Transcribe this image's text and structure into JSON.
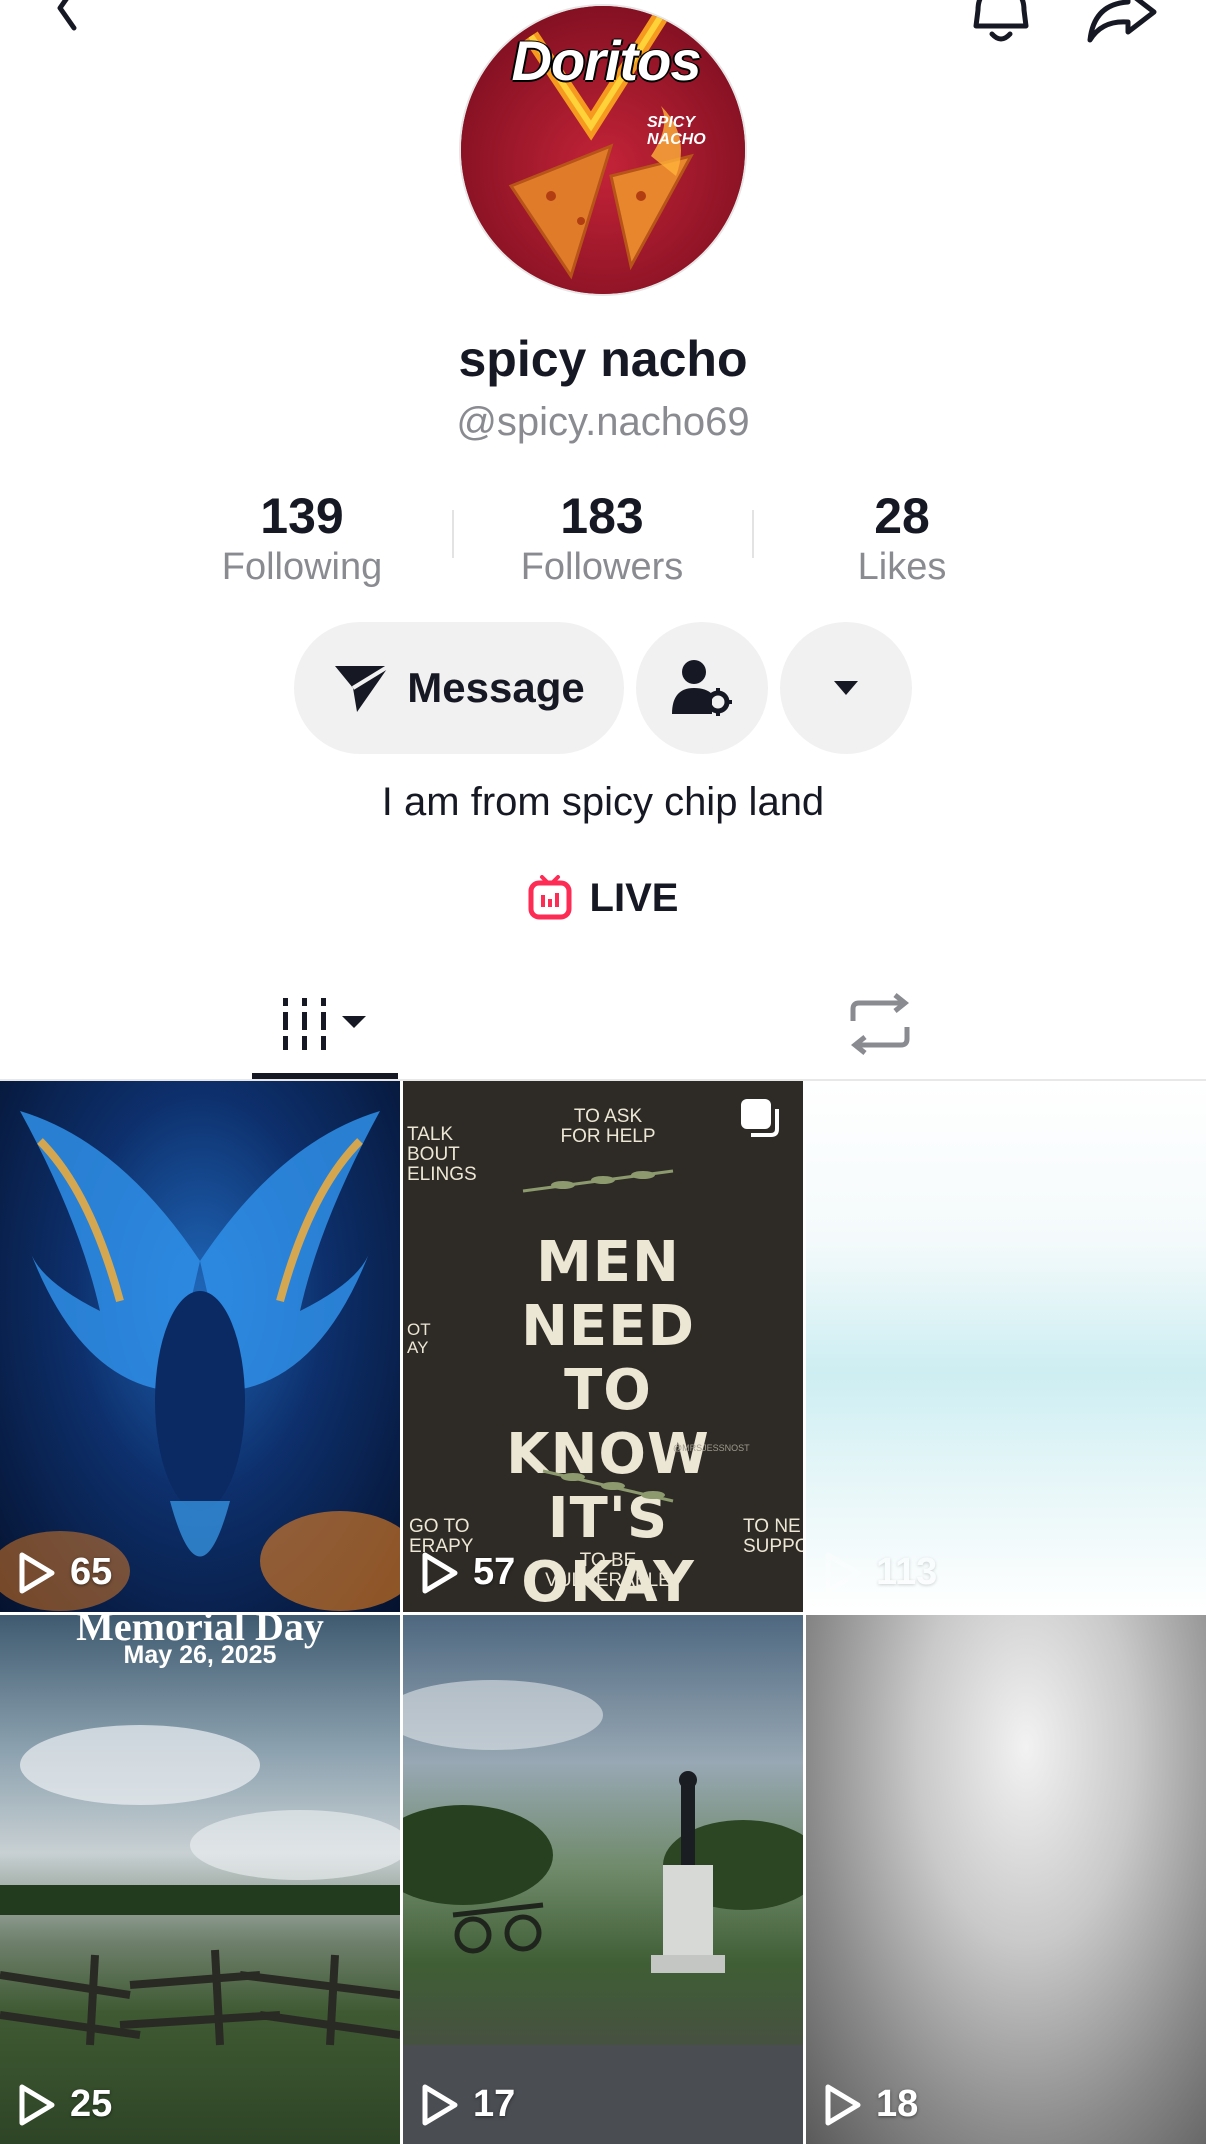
{
  "profile": {
    "display_name": "spicy nacho",
    "username": "@spicy.nacho69",
    "avatar_label": "Doritos",
    "avatar_sub": "SPICY NACHO",
    "bio": "I am from spicy chip land"
  },
  "stats": [
    {
      "value": "139",
      "label": "Following"
    },
    {
      "value": "183",
      "label": "Followers"
    },
    {
      "value": "28",
      "label": "Likes"
    }
  ],
  "actions": {
    "message_label": "Message",
    "live_label": "LIVE"
  },
  "videos": [
    {
      "views": "65",
      "overlay": ""
    },
    {
      "views": "57",
      "overlay": "MEN NEED TO KNOW IT'S OKAY"
    },
    {
      "views": "113",
      "overlay": ""
    },
    {
      "views": "25",
      "overlay": "Memorial Day",
      "overlay_sub": "May 26, 2025"
    },
    {
      "views": "17",
      "overlay": ""
    },
    {
      "views": "18",
      "overlay": ""
    }
  ],
  "tile2_text": {
    "top_left": "TALK BOUT ELINGS",
    "top_center": "TO ASK FOR HELP",
    "mid_left": "OT AY",
    "bottom_left": "GO TO ERAPY",
    "bottom_center": "TO BE VULNERABLE",
    "bottom_right": "TO NE SUPPO",
    "mark": "@MRSJESSNOST"
  },
  "colors": {
    "accent_live": "#fe2c55",
    "text_primary": "#161823",
    "text_secondary": "#8a8b91",
    "pill_bg": "#f1f1f2"
  }
}
